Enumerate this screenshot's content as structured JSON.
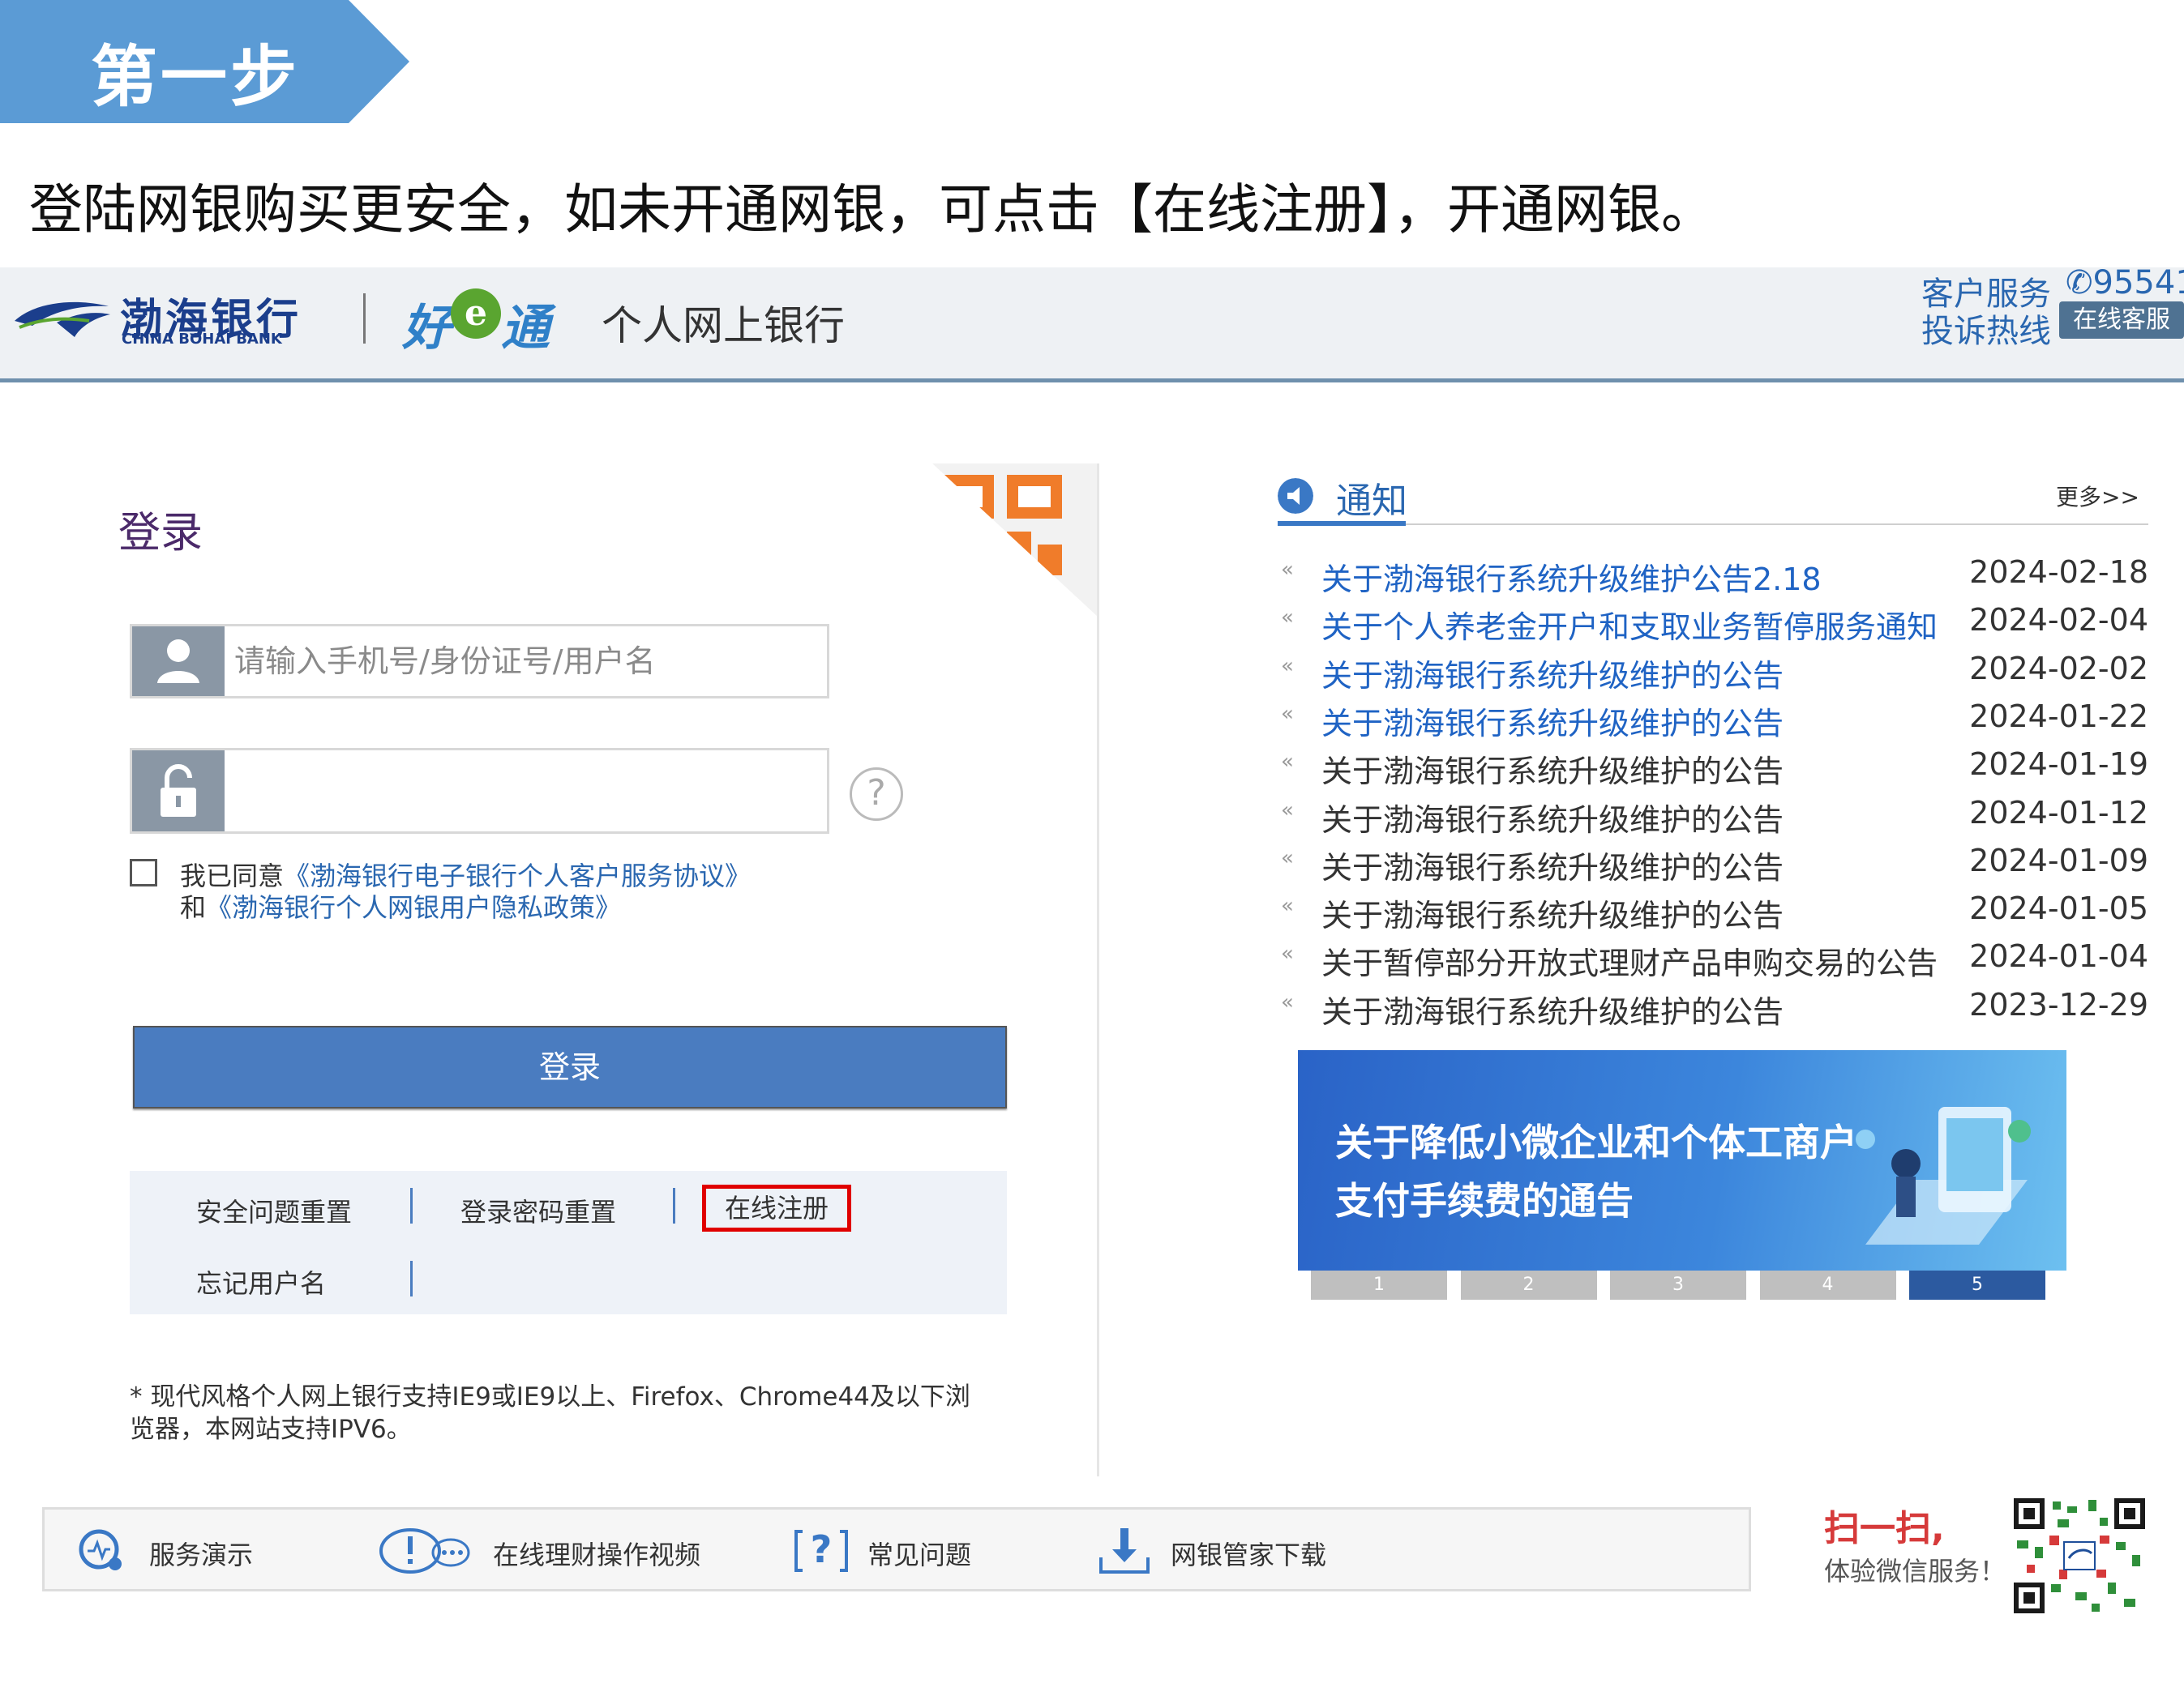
{
  "step": {
    "label": "第一步"
  },
  "intro": "登陆网银购买更安全，如未开通网银，可点击【在线注册】，开通网银。",
  "header": {
    "bank_name_cn": "渤海银行",
    "bank_name_en": "CHINA BOHAI BANK",
    "brand_left": "好",
    "brand_e": "e",
    "brand_right": "通",
    "site_title": "个人网上银行",
    "customer_service": "客户服务",
    "complaint_hotline": "投诉热线",
    "phone": "95541",
    "online_service": "在线客服"
  },
  "login": {
    "title": "登录",
    "username_placeholder": "请输入手机号/身份证号/用户名",
    "password_value": "",
    "help": "?",
    "agree_prefix": "我已同意",
    "agreement_link": "《渤海银行电子银行个人客户服务协议》",
    "and": "和",
    "privacy_link": "《渤海银行个人网银用户隐私政策》",
    "button": "登录",
    "links": {
      "security_reset": "安全问题重置",
      "password_reset": "登录密码重置",
      "register": "在线注册",
      "forgot_username": "忘记用户名"
    },
    "note_line1": "* 现代风格个人网上银行支持IE9或IE9以上、Firefox、Chrome44及以下浏",
    "note_line2": "览器，本网站支持IPV6。"
  },
  "notice": {
    "title": "通知",
    "more": "更多>>",
    "items": [
      {
        "title": "关于渤海银行系统升级维护公告2.18",
        "date": "2024-02-18",
        "highlight": true
      },
      {
        "title": "关于个人养老金开户和支取业务暂停服务通知",
        "date": "2024-02-04",
        "highlight": true
      },
      {
        "title": "关于渤海银行系统升级维护的公告",
        "date": "2024-02-02",
        "highlight": true
      },
      {
        "title": "关于渤海银行系统升级维护的公告",
        "date": "2024-01-22",
        "highlight": true
      },
      {
        "title": "关于渤海银行系统升级维护的公告",
        "date": "2024-01-19",
        "highlight": false
      },
      {
        "title": "关于渤海银行系统升级维护的公告",
        "date": "2024-01-12",
        "highlight": false
      },
      {
        "title": "关于渤海银行系统升级维护的公告",
        "date": "2024-01-09",
        "highlight": false
      },
      {
        "title": "关于渤海银行系统升级维护的公告",
        "date": "2024-01-05",
        "highlight": false
      },
      {
        "title": "关于暂停部分开放式理财产品申购交易的公告",
        "date": "2024-01-04",
        "highlight": false
      },
      {
        "title": "关于渤海银行系统升级维护的公告",
        "date": "2023-12-29",
        "highlight": false
      }
    ],
    "banner_line1": "关于降低小微企业和个体工商户",
    "banner_line2": "支付手续费的通告",
    "pages": [
      "1",
      "2",
      "3",
      "4",
      "5"
    ],
    "active_page": 5
  },
  "bottom": {
    "service_demo": "服务演示",
    "video": "在线理财操作视频",
    "faq": "常见问题",
    "download": "网银管家下载",
    "scan_title": "扫一扫,",
    "scan_sub": "体验微信服务！"
  },
  "colors": {
    "step_blue": "#5b9bd5",
    "primary": "#4a7cc0",
    "link": "#1f63c4",
    "register_highlight": "#e00000"
  }
}
